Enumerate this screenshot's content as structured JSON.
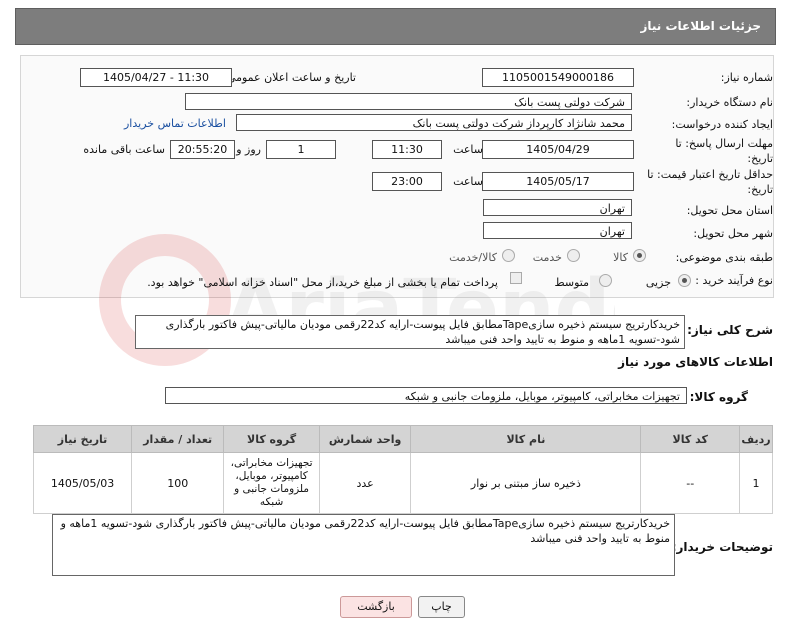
{
  "header": {
    "title": "جزئیات اطلاعات نیاز"
  },
  "form": {
    "need_number_label": "شماره نیاز:",
    "need_number": "1105001549000186",
    "announce_label": "تاریخ و ساعت اعلان عمومی:",
    "announce_value": "1405/04/27 - 11:30",
    "buyer_org_label": "نام دستگاه خریدار:",
    "buyer_org": "شرکت دولتی پست بانک",
    "requester_label": "ایجاد کننده درخواست:",
    "requester": "محمد شانژاد کارپرداز شرکت دولتی پست بانک",
    "contact_link": "اطلاعات تماس خریدار",
    "deadline_label": "مهلت ارسال پاسخ: تا تاریخ:",
    "deadline_date": "1405/04/29",
    "time_label": "ساعت",
    "deadline_time": "11:30",
    "days_value": "1",
    "days_label": "روز و",
    "remaining_time": "20:55:20",
    "remaining_label": "ساعت باقی مانده",
    "validity_label": "حداقل تاریخ اعتبار قیمت: تا تاریخ:",
    "validity_date": "1405/05/17",
    "validity_time": "23:00",
    "province_label": "استان محل تحویل:",
    "province": "تهران",
    "city_label": "شهر محل تحویل:",
    "city": "تهران",
    "category_label": "طبقه بندی موضوعی:",
    "category_options": [
      "کالا",
      "خدمت",
      "کالا/خدمت"
    ],
    "category_selected": "کالا",
    "process_label": "نوع فرآیند خرید :",
    "process_options": [
      "جزیی",
      "متوسط"
    ],
    "process_selected": "جزیی",
    "payment_note": "پرداخت تمام یا بخشی از مبلغ خرید،از محل \"اسناد خزانه اسلامی\" خواهد بود."
  },
  "summary": {
    "label": "شرح کلی نیاز:",
    "text": "خریدکارتریج سیستم ذخیره سازیTapeمطابق فایل پیوست-ارایه کد22رقمی مودیان مالیاتی-پیش فاکتور بارگذاری شود-تسویه 1ماهه و منوط به تایید واحد فنی میباشد"
  },
  "goods": {
    "section_title": "اطلاعات کالاهای مورد نیاز",
    "group_label": "گروه کالا:",
    "group_value": "تجهیزات مخابراتی، کامپیوتر، موبایل، ملزومات جانبی و شبکه",
    "columns": [
      "ردیف",
      "کد کالا",
      "نام کالا",
      "واحد شمارش",
      "گروه کالا",
      "تعداد / مقدار",
      "تاریخ نیاز"
    ],
    "rows": [
      [
        "1",
        "--",
        "ذخیره ساز مبتنی بر نوار",
        "عدد",
        "تجهیزات مخابراتی، کامپیوتر، موبایل، ملزومات جانبی و شبکه",
        "100",
        "1405/05/03"
      ]
    ]
  },
  "buyer_notes": {
    "label": "توضیحات خریدار:",
    "text": "خریدکارتریج سیستم ذخیره سازیTapeمطابق فایل پیوست-ارایه کد22رقمی مودیان مالیاتی-پیش فاکتور بارگذاری شود-تسویه 1ماهه و منوط به تایید واحد فنی میباشد"
  },
  "buttons": {
    "print": "چاپ",
    "back": "بازگشت"
  },
  "watermark_text": "AriaTender.net"
}
